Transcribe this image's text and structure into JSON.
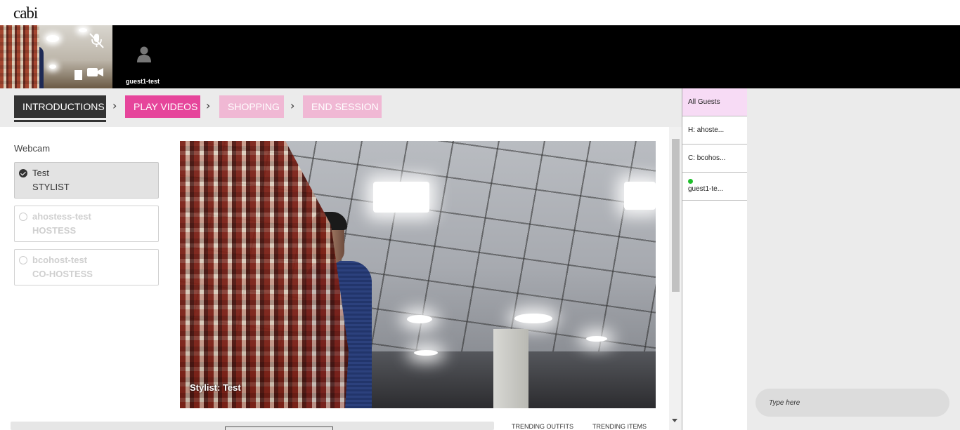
{
  "app": {
    "logo": "cabi"
  },
  "video_strip": {
    "self_controls": {
      "mic_icon": "mic-off-icon",
      "camera_icon": "video-camera-icon"
    },
    "participants": [
      {
        "name": "guest1-test",
        "icon": "user-avatar-icon"
      }
    ]
  },
  "steps": {
    "items": [
      {
        "label": "INTRODUCTIONS",
        "state": "active"
      },
      {
        "label": "PLAY VIDEOS",
        "state": "enabled"
      },
      {
        "label": "SHOPPING",
        "state": "disabled"
      },
      {
        "label": "END SESSION",
        "state": "disabled"
      }
    ],
    "separator_icon": "chevron-right-icon"
  },
  "webcam": {
    "label": "Webcam",
    "people": [
      {
        "name": "Test",
        "role": "STYLIST",
        "selected": true
      },
      {
        "name": "ahostess-test",
        "role": "HOSTESS",
        "selected": false
      },
      {
        "name": "bcohost-test",
        "role": "CO-HOSTESS",
        "selected": false
      }
    ],
    "caption": "Stylist: Test"
  },
  "bottom": {
    "tabs": [
      "TRENDING OUTFITS",
      "TRENDING ITEMS"
    ]
  },
  "guests": {
    "items": [
      {
        "label": "All Guests",
        "selected": true
      },
      {
        "label": "H: ahoste..."
      },
      {
        "label": "C: bcohos..."
      },
      {
        "label": "guest1-te...",
        "online": true
      }
    ]
  },
  "chat": {
    "placeholder": "Type here"
  },
  "colors": {
    "accent": "#e6459b",
    "accent_disabled": "#f0b8d4",
    "active_step": "#333333",
    "guest_selected": "#f7dbf5",
    "online": "#1fbf2b"
  }
}
